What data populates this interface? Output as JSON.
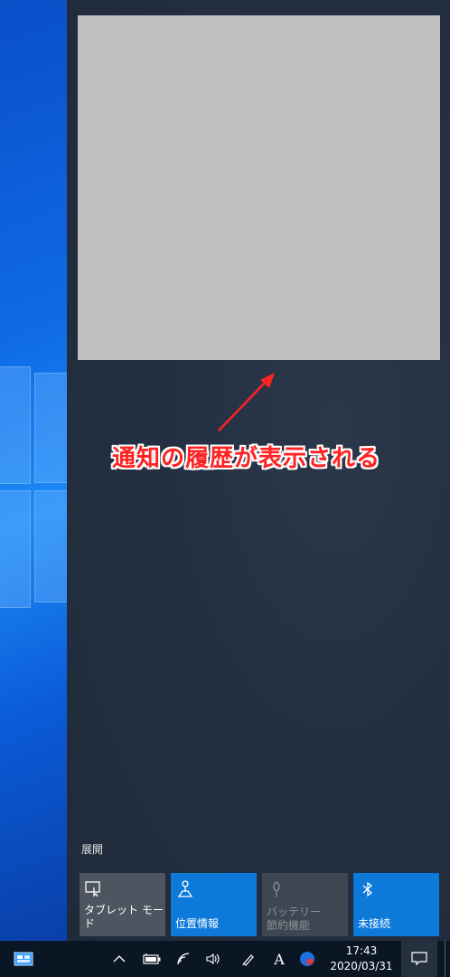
{
  "annotation": {
    "text": "通知の履歴が表示される",
    "color": "#ff2222"
  },
  "action_center": {
    "expand_label": "展開"
  },
  "quick_actions": [
    {
      "label": "タブレット モード",
      "state": "off",
      "icon": "tablet-mode-icon"
    },
    {
      "label": "位置情報",
      "state": "on",
      "icon": "location-icon"
    },
    {
      "label": "バッテリー\n節約機能",
      "state": "disabled",
      "icon": "battery-saver-icon"
    },
    {
      "label": "未接続",
      "state": "on",
      "icon": "bluetooth-icon"
    }
  ],
  "taskbar": {
    "clock_time": "17:43",
    "clock_date": "2020/03/31",
    "tray_icons": [
      "chevron-up-icon",
      "battery-icon",
      "wifi-icon",
      "volume-icon",
      "pen-icon",
      "ime-icon",
      "app-icon"
    ],
    "ime_label": "A"
  },
  "colors": {
    "accent": "#0d79d8",
    "panel": "#243042",
    "taskbar": "#0b1624"
  }
}
